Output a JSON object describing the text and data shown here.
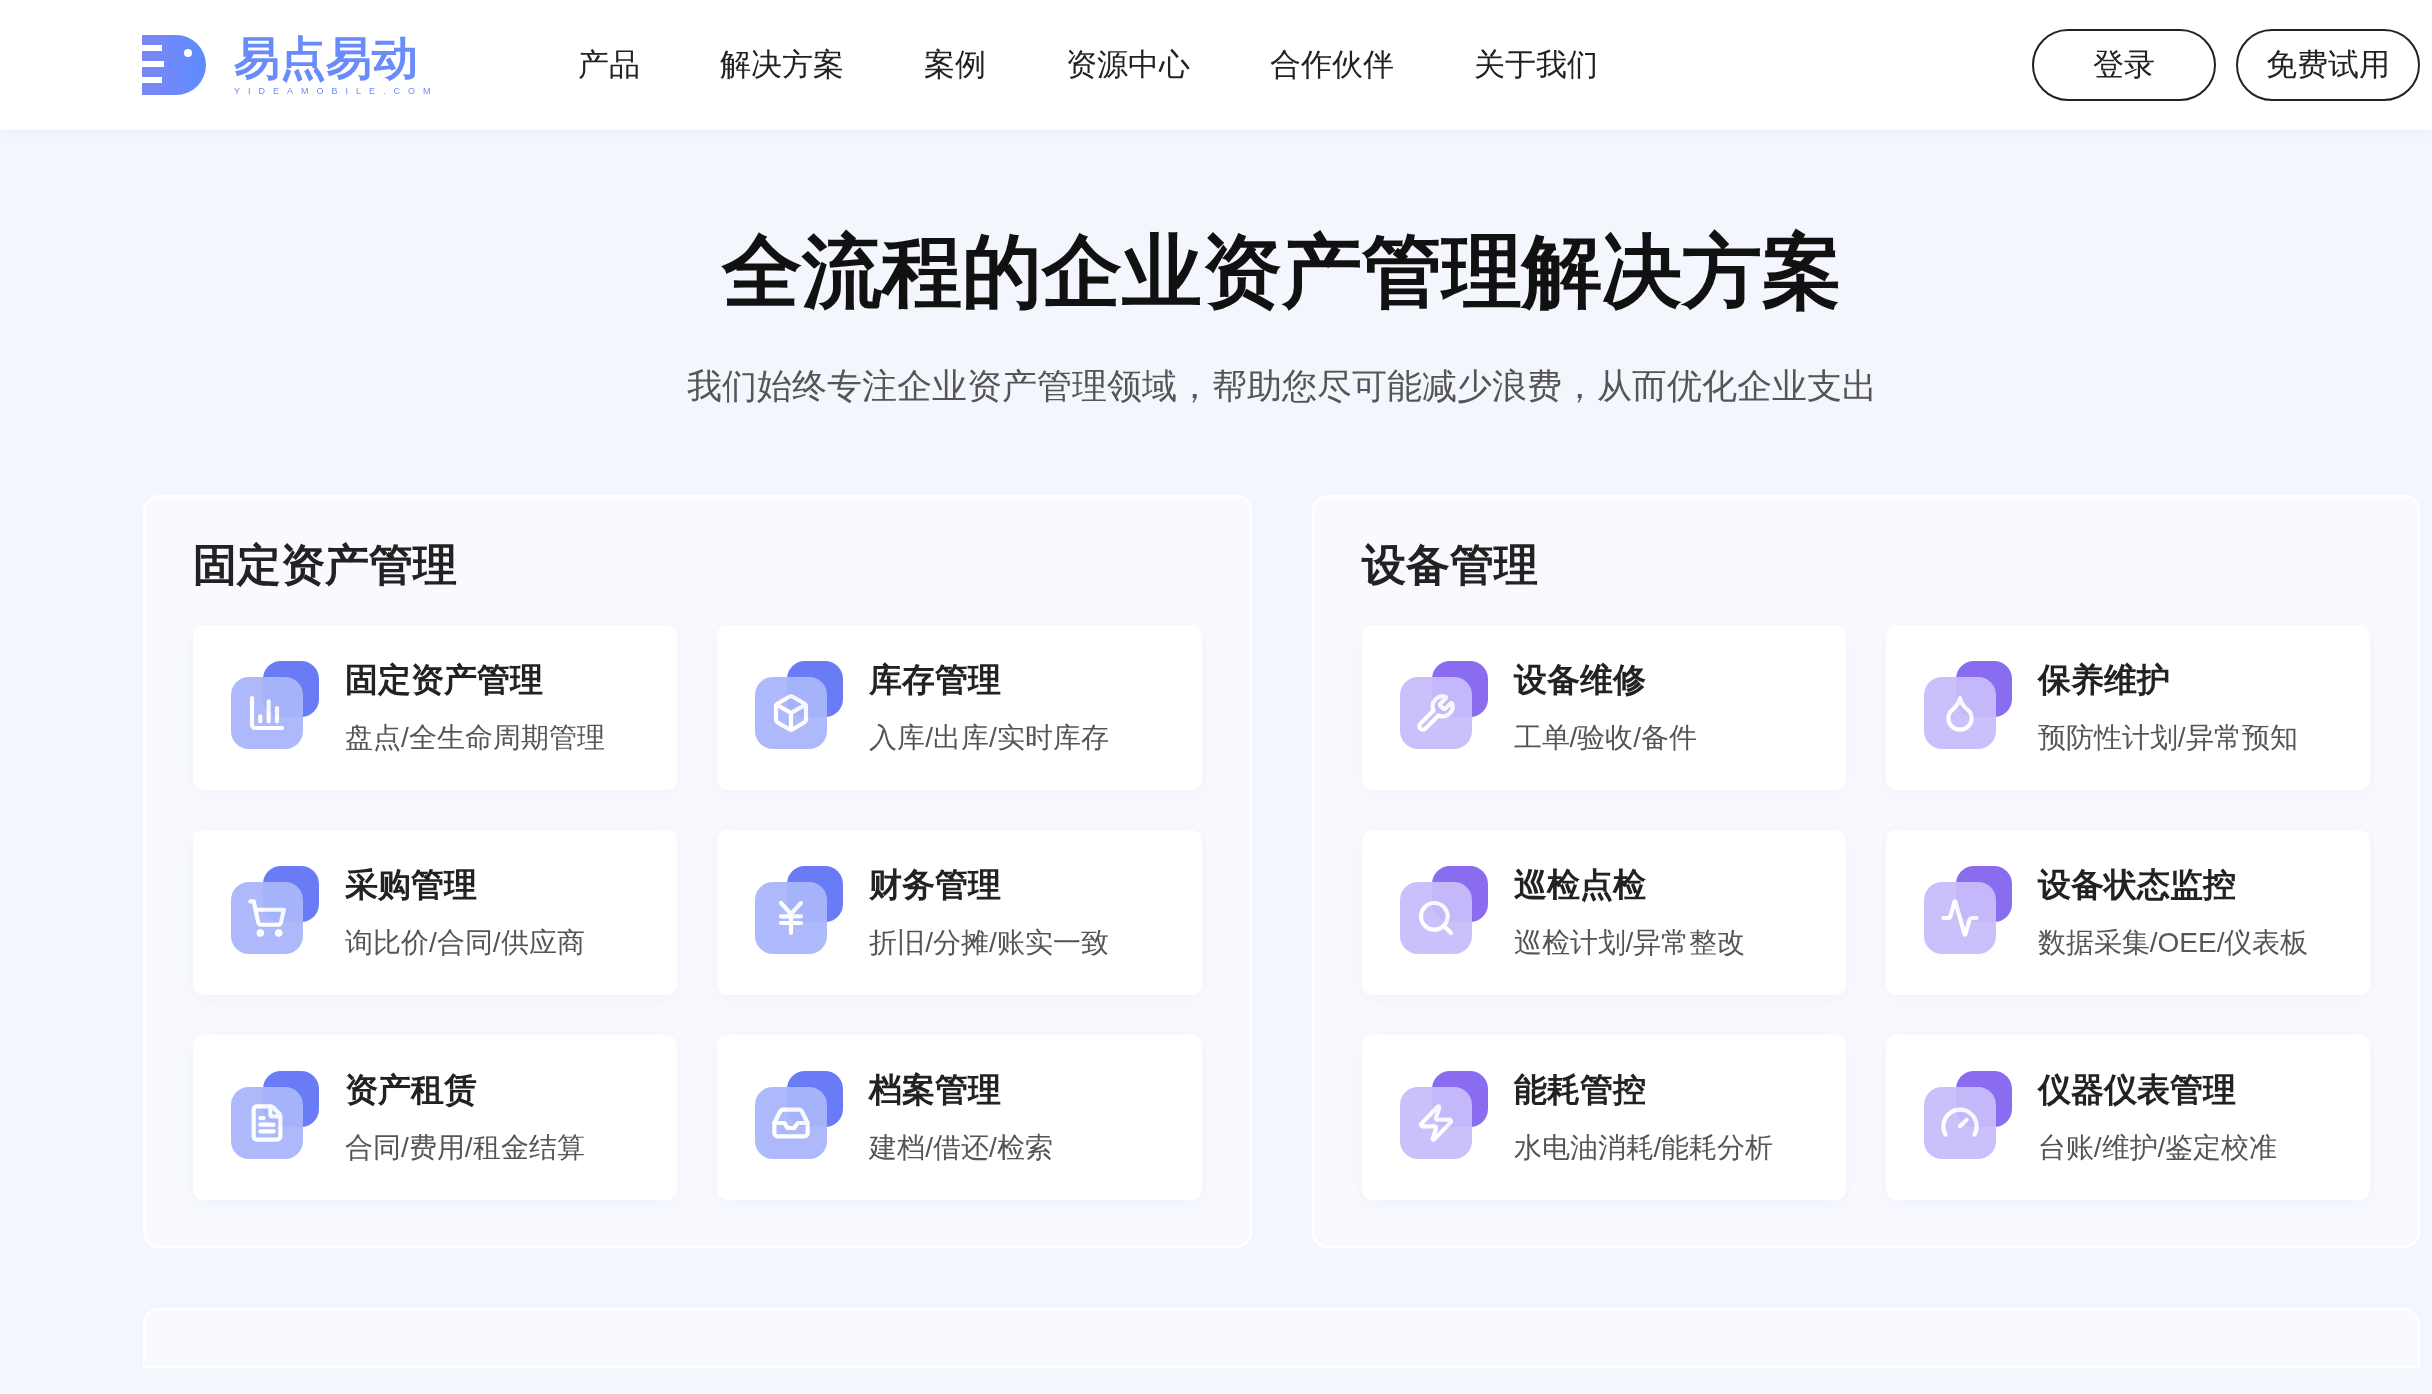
{
  "header": {
    "logo": {
      "name": "易点易动",
      "tagline": "YIDEAMOBILE.COM"
    },
    "nav": [
      "产品",
      "解决方案",
      "案例",
      "资源中心",
      "合作伙伴",
      "关于我们"
    ],
    "buttons": [
      "登录",
      "免费试用"
    ]
  },
  "hero": {
    "title": "全流程的企业资产管理解决方案",
    "subtitle": "我们始终专注企业资产管理领域，帮助您尽可能减少浪费，从而优化企业支出"
  },
  "panels": [
    {
      "title": "固定资产管理",
      "items": [
        {
          "title": "固定资产管理",
          "desc": "盘点/全生命周期管理"
        },
        {
          "title": "库存管理",
          "desc": "入库/出库/实时库存"
        },
        {
          "title": "采购管理",
          "desc": "询比价/合同/供应商"
        },
        {
          "title": "财务管理",
          "desc": "折旧/分摊/账实一致"
        },
        {
          "title": "资产租赁",
          "desc": "合同/费用/租金结算"
        },
        {
          "title": "档案管理",
          "desc": "建档/借还/检索"
        }
      ]
    },
    {
      "title": "设备管理",
      "items": [
        {
          "title": "设备维修",
          "desc": "工单/验收/备件"
        },
        {
          "title": "保养维护",
          "desc": "预防性计划/异常预知"
        },
        {
          "title": "巡检点检",
          "desc": "巡检计划/异常整改"
        },
        {
          "title": "设备状态监控",
          "desc": "数据采集/OEE/仪表板"
        },
        {
          "title": "能耗管控",
          "desc": "水电油消耗/能耗分析"
        },
        {
          "title": "仪器仪表管理",
          "desc": "台账/维护/鉴定校准"
        }
      ]
    }
  ]
}
